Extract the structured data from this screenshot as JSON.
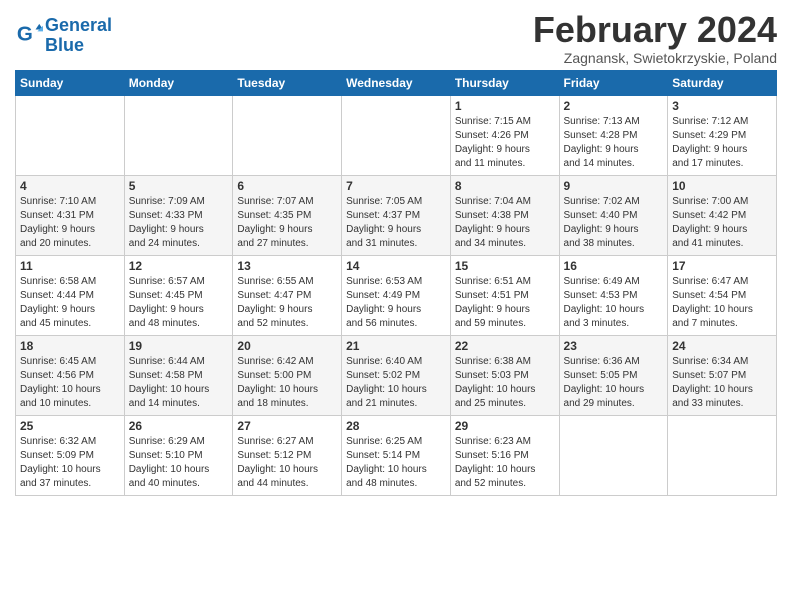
{
  "header": {
    "logo_line1": "General",
    "logo_line2": "Blue",
    "month_title": "February 2024",
    "subtitle": "Zagnansk, Swietokrzyskie, Poland"
  },
  "columns": [
    "Sunday",
    "Monday",
    "Tuesday",
    "Wednesday",
    "Thursday",
    "Friday",
    "Saturday"
  ],
  "weeks": [
    [
      {
        "day": "",
        "info": ""
      },
      {
        "day": "",
        "info": ""
      },
      {
        "day": "",
        "info": ""
      },
      {
        "day": "",
        "info": ""
      },
      {
        "day": "1",
        "info": "Sunrise: 7:15 AM\nSunset: 4:26 PM\nDaylight: 9 hours\nand 11 minutes."
      },
      {
        "day": "2",
        "info": "Sunrise: 7:13 AM\nSunset: 4:28 PM\nDaylight: 9 hours\nand 14 minutes."
      },
      {
        "day": "3",
        "info": "Sunrise: 7:12 AM\nSunset: 4:29 PM\nDaylight: 9 hours\nand 17 minutes."
      }
    ],
    [
      {
        "day": "4",
        "info": "Sunrise: 7:10 AM\nSunset: 4:31 PM\nDaylight: 9 hours\nand 20 minutes."
      },
      {
        "day": "5",
        "info": "Sunrise: 7:09 AM\nSunset: 4:33 PM\nDaylight: 9 hours\nand 24 minutes."
      },
      {
        "day": "6",
        "info": "Sunrise: 7:07 AM\nSunset: 4:35 PM\nDaylight: 9 hours\nand 27 minutes."
      },
      {
        "day": "7",
        "info": "Sunrise: 7:05 AM\nSunset: 4:37 PM\nDaylight: 9 hours\nand 31 minutes."
      },
      {
        "day": "8",
        "info": "Sunrise: 7:04 AM\nSunset: 4:38 PM\nDaylight: 9 hours\nand 34 minutes."
      },
      {
        "day": "9",
        "info": "Sunrise: 7:02 AM\nSunset: 4:40 PM\nDaylight: 9 hours\nand 38 minutes."
      },
      {
        "day": "10",
        "info": "Sunrise: 7:00 AM\nSunset: 4:42 PM\nDaylight: 9 hours\nand 41 minutes."
      }
    ],
    [
      {
        "day": "11",
        "info": "Sunrise: 6:58 AM\nSunset: 4:44 PM\nDaylight: 9 hours\nand 45 minutes."
      },
      {
        "day": "12",
        "info": "Sunrise: 6:57 AM\nSunset: 4:45 PM\nDaylight: 9 hours\nand 48 minutes."
      },
      {
        "day": "13",
        "info": "Sunrise: 6:55 AM\nSunset: 4:47 PM\nDaylight: 9 hours\nand 52 minutes."
      },
      {
        "day": "14",
        "info": "Sunrise: 6:53 AM\nSunset: 4:49 PM\nDaylight: 9 hours\nand 56 minutes."
      },
      {
        "day": "15",
        "info": "Sunrise: 6:51 AM\nSunset: 4:51 PM\nDaylight: 9 hours\nand 59 minutes."
      },
      {
        "day": "16",
        "info": "Sunrise: 6:49 AM\nSunset: 4:53 PM\nDaylight: 10 hours\nand 3 minutes."
      },
      {
        "day": "17",
        "info": "Sunrise: 6:47 AM\nSunset: 4:54 PM\nDaylight: 10 hours\nand 7 minutes."
      }
    ],
    [
      {
        "day": "18",
        "info": "Sunrise: 6:45 AM\nSunset: 4:56 PM\nDaylight: 10 hours\nand 10 minutes."
      },
      {
        "day": "19",
        "info": "Sunrise: 6:44 AM\nSunset: 4:58 PM\nDaylight: 10 hours\nand 14 minutes."
      },
      {
        "day": "20",
        "info": "Sunrise: 6:42 AM\nSunset: 5:00 PM\nDaylight: 10 hours\nand 18 minutes."
      },
      {
        "day": "21",
        "info": "Sunrise: 6:40 AM\nSunset: 5:02 PM\nDaylight: 10 hours\nand 21 minutes."
      },
      {
        "day": "22",
        "info": "Sunrise: 6:38 AM\nSunset: 5:03 PM\nDaylight: 10 hours\nand 25 minutes."
      },
      {
        "day": "23",
        "info": "Sunrise: 6:36 AM\nSunset: 5:05 PM\nDaylight: 10 hours\nand 29 minutes."
      },
      {
        "day": "24",
        "info": "Sunrise: 6:34 AM\nSunset: 5:07 PM\nDaylight: 10 hours\nand 33 minutes."
      }
    ],
    [
      {
        "day": "25",
        "info": "Sunrise: 6:32 AM\nSunset: 5:09 PM\nDaylight: 10 hours\nand 37 minutes."
      },
      {
        "day": "26",
        "info": "Sunrise: 6:29 AM\nSunset: 5:10 PM\nDaylight: 10 hours\nand 40 minutes."
      },
      {
        "day": "27",
        "info": "Sunrise: 6:27 AM\nSunset: 5:12 PM\nDaylight: 10 hours\nand 44 minutes."
      },
      {
        "day": "28",
        "info": "Sunrise: 6:25 AM\nSunset: 5:14 PM\nDaylight: 10 hours\nand 48 minutes."
      },
      {
        "day": "29",
        "info": "Sunrise: 6:23 AM\nSunset: 5:16 PM\nDaylight: 10 hours\nand 52 minutes."
      },
      {
        "day": "",
        "info": ""
      },
      {
        "day": "",
        "info": ""
      }
    ]
  ]
}
